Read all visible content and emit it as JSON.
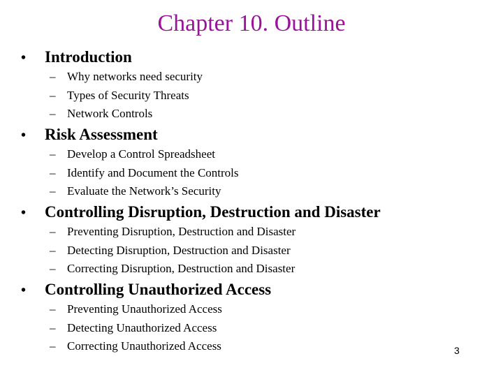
{
  "slide": {
    "title": "Chapter 10. Outline",
    "page_number": "3",
    "title_color": "#99149b",
    "sections": [
      {
        "label": "Introduction",
        "items": [
          "Why networks need security",
          "Types of Security Threats",
          "Network Controls"
        ]
      },
      {
        "label": "Risk Assessment",
        "items": [
          "Develop a Control Spreadsheet",
          "Identify and Document the Controls",
          "Evaluate the Network’s Security"
        ]
      },
      {
        "label": "Controlling Disruption, Destruction and Disaster",
        "items": [
          "Preventing Disruption, Destruction and Disaster",
          "Detecting Disruption, Destruction and Disaster",
          "Correcting Disruption, Destruction and Disaster"
        ]
      },
      {
        "label": "Controlling Unauthorized Access",
        "items": [
          "Preventing Unauthorized Access",
          "Detecting Unauthorized Access",
          "Correcting Unauthorized Access"
        ]
      }
    ],
    "bullet_glyph": "•",
    "dash_glyph": "–"
  }
}
